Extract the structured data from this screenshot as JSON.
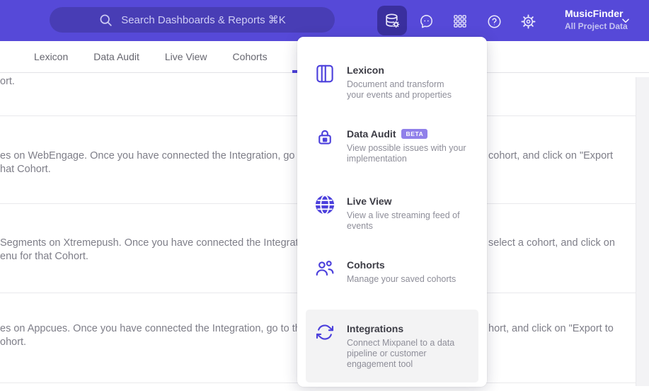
{
  "colors": {
    "header_bg": "#5649d8",
    "header_active_tool_bg": "#3a2f9e",
    "accent": "#4c40dc",
    "badge_bg": "#9080ea",
    "menu_highlight_bg": "#f3f3f4"
  },
  "header": {
    "search": {
      "placeholder": "Search Dashboards & Reports ⌘K"
    },
    "project": {
      "name": "MusicFinder",
      "scope": "All Project Data"
    }
  },
  "nav": {
    "tabs": [
      {
        "label": "Lexicon"
      },
      {
        "label": "Data Audit"
      },
      {
        "label": "Live View"
      },
      {
        "label": "Cohorts"
      }
    ]
  },
  "menu": {
    "items": [
      {
        "title": "Lexicon",
        "desc": "Document and transform\nyour events and properties"
      },
      {
        "title": "Data Audit",
        "badge": "BETA",
        "desc": "View possible issues with your\nimplementation"
      },
      {
        "title": "Live View",
        "desc": "View a live streaming feed of\nevents"
      },
      {
        "title": "Cohorts",
        "desc": "Manage your saved cohorts"
      },
      {
        "title": "Integrations",
        "desc": "Connect Mixpanel to a data\npipeline or customer\nengagement tool",
        "highlighted": true
      }
    ]
  },
  "background": {
    "rows": [
      {
        "line1": "ort."
      },
      {
        "line1": "es on WebEngage. Once you have connected the Integration, go to the",
        "right1": "cohort, and click on \"Export",
        "line2": "hat Cohort."
      },
      {
        "line1": "Segments on Xtremepush. Once you have connected the Integration,",
        "right1": "select a cohort, and click on",
        "line2": "enu for that Cohort."
      },
      {
        "line1": "es on Appcues. Once you have connected the Integration, go to the M",
        "right1": "hort, and click on \"Export to",
        "line2": "ohort."
      }
    ]
  }
}
